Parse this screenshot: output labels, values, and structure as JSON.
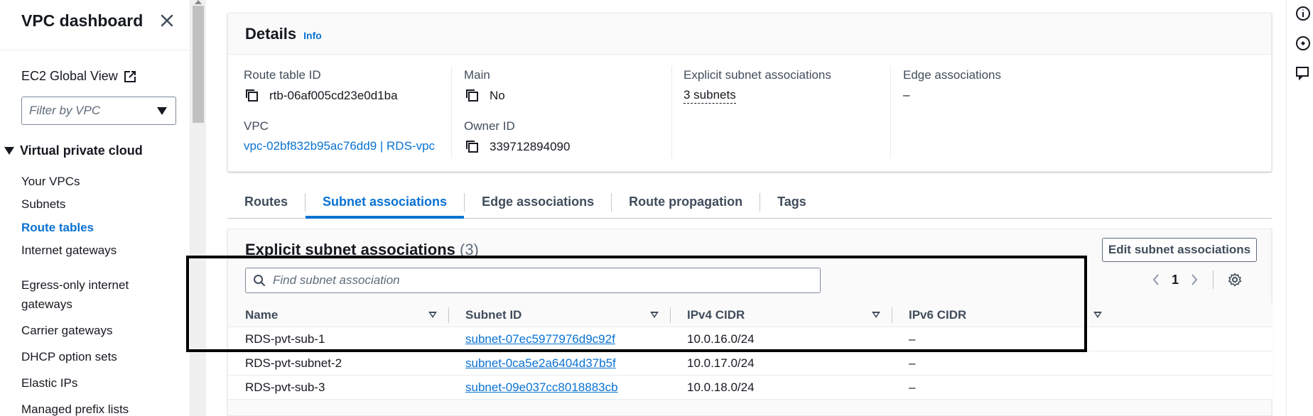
{
  "sidebar": {
    "title": "VPC dashboard",
    "global_view": "EC2 Global View",
    "filter_placeholder": "Filter by VPC",
    "section": "Virtual private cloud",
    "items": [
      {
        "label": "Your VPCs",
        "active": false
      },
      {
        "label": "Subnets",
        "active": false
      },
      {
        "label": "Route tables",
        "active": true
      },
      {
        "label": "Internet gateways",
        "active": false
      },
      {
        "label": "Egress-only internet gateways",
        "active": false
      },
      {
        "label": "Carrier gateways",
        "active": false
      },
      {
        "label": "DHCP option sets",
        "active": false
      },
      {
        "label": "Elastic IPs",
        "active": false
      },
      {
        "label": "Managed prefix lists",
        "active": false
      }
    ]
  },
  "details": {
    "title": "Details",
    "info": "Info",
    "route_table_id_label": "Route table ID",
    "route_table_id": "rtb-06af005cd23e0d1ba",
    "vpc_label": "VPC",
    "vpc": "vpc-02bf832b95ac76dd9 | RDS-vpc",
    "main_label": "Main",
    "main": "No",
    "owner_label": "Owner ID",
    "owner": "339712894090",
    "explicit_label": "Explicit subnet associations",
    "explicit": "3 subnets",
    "edge_label": "Edge associations",
    "edge": "–"
  },
  "tabs": [
    {
      "label": "Routes",
      "active": false
    },
    {
      "label": "Subnet associations",
      "active": true
    },
    {
      "label": "Edge associations",
      "active": false
    },
    {
      "label": "Route propagation",
      "active": false
    },
    {
      "label": "Tags",
      "active": false
    }
  ],
  "assoc": {
    "title": "Explicit subnet associations",
    "count": "(3)",
    "edit_button": "Edit subnet associations",
    "search_placeholder": "Find subnet association",
    "page": "1",
    "columns": [
      "Name",
      "Subnet ID",
      "IPv4 CIDR",
      "IPv6 CIDR"
    ],
    "rows": [
      {
        "name": "RDS-pvt-sub-1",
        "subnet": "subnet-07ec5977976d9c92f",
        "ipv4": "10.0.16.0/24",
        "ipv6": "–"
      },
      {
        "name": "RDS-pvt-subnet-2",
        "subnet": "subnet-0ca5e2a6404d37b5f",
        "ipv4": "10.0.17.0/24",
        "ipv6": "–"
      },
      {
        "name": "RDS-pvt-sub-3",
        "subnet": "subnet-09e037cc8018883cb",
        "ipv4": "10.0.18.0/24",
        "ipv6": "–"
      }
    ]
  },
  "colors": {
    "accent": "#0972d3",
    "text": "#16191f",
    "muted": "#414d5c"
  }
}
